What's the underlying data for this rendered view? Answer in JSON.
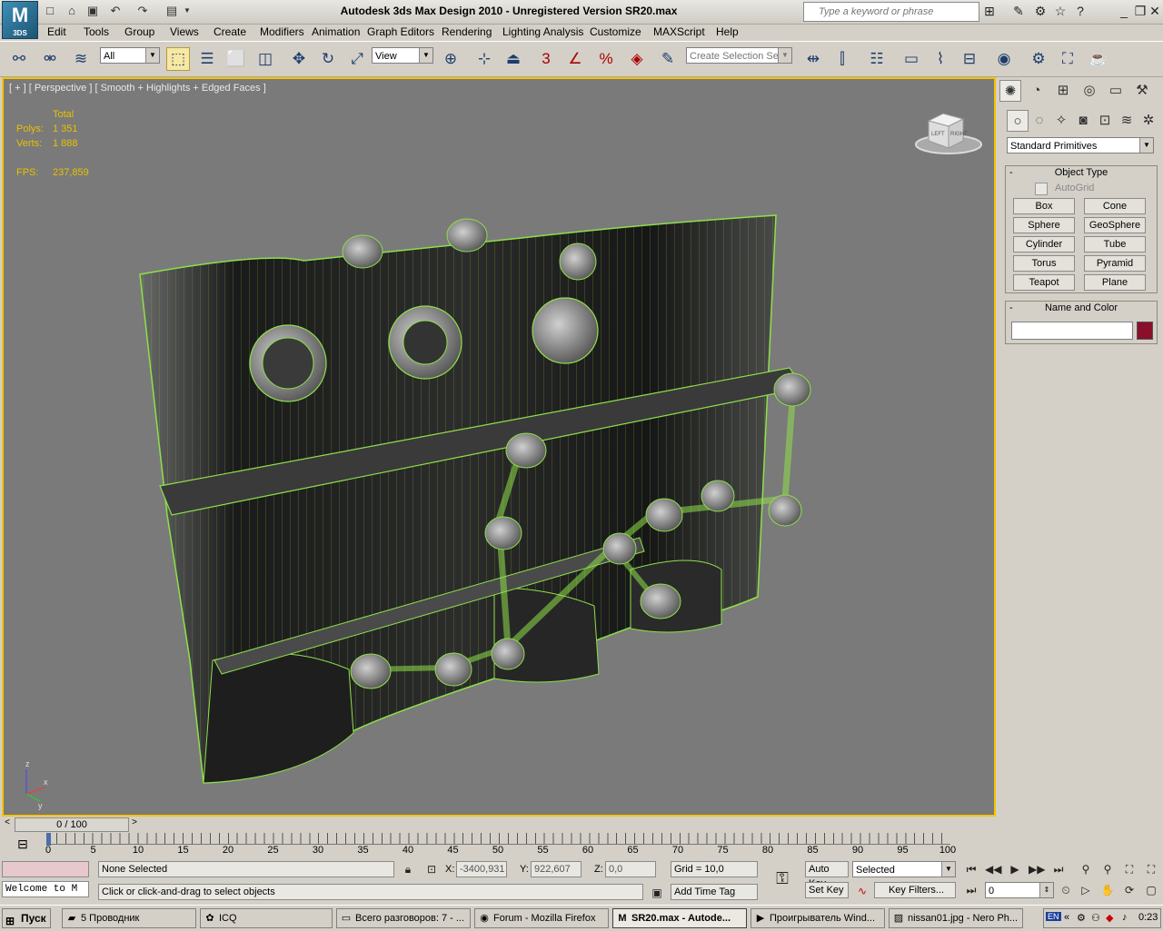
{
  "app": {
    "logo_text": "M",
    "logo_sub": "3DS",
    "title": "Autodesk 3ds Max Design 2010  - Unregistered Version    SR20.max"
  },
  "search": {
    "placeholder": "Type a keyword or phrase"
  },
  "menu": [
    "Edit",
    "Tools",
    "Group",
    "Views",
    "Create",
    "Modifiers",
    "Animation",
    "Graph Editors",
    "Rendering",
    "Lighting Analysis",
    "Customize",
    "MAXScript",
    "Help"
  ],
  "toolbar": {
    "selection_filter": "All",
    "reference_coord": "View",
    "snap_number": "3",
    "named_selection_placeholder": "Create Selection Se"
  },
  "viewport": {
    "label": "[ + ] [ Perspective ] [ Smooth + Highlights + Edged Faces ]",
    "stats_header": "Total",
    "polys_label": "Polys:",
    "polys_value": "1 351",
    "verts_label": "Verts:",
    "verts_value": "1 888",
    "fps_label": "FPS:",
    "fps_value": "237,859",
    "viewcube_left": "LEFT",
    "viewcube_right": "RIGHT",
    "axis_z": "z",
    "axis_x": "x",
    "axis_y": "y"
  },
  "command_panel": {
    "category_dropdown": "Standard Primitives",
    "object_type_title": "Object Type",
    "autogrid_label": "AutoGrid",
    "buttons": [
      "Box",
      "Cone",
      "Sphere",
      "GeoSphere",
      "Cylinder",
      "Tube",
      "Torus",
      "Pyramid",
      "Teapot",
      "Plane"
    ],
    "name_color_title": "Name and Color",
    "name_value": "",
    "object_color": "#8b0f2a",
    "rollout_minus": "-"
  },
  "timeline": {
    "frame_display": "0 / 100",
    "ticks": [
      "0",
      "5",
      "10",
      "15",
      "20",
      "25",
      "30",
      "35",
      "40",
      "45",
      "50",
      "55",
      "60",
      "65",
      "70",
      "75",
      "80",
      "85",
      "90",
      "95",
      "100"
    ]
  },
  "status": {
    "maxscript_listener": "Welcome to M",
    "selection_text": "None Selected",
    "prompt": "Click or click-and-drag to select objects",
    "x_label": "X:",
    "x_value": "-3400,931",
    "y_label": "Y:",
    "y_value": "922,607",
    "z_label": "Z:",
    "z_value": "0,0",
    "grid": "Grid = 10,0",
    "add_time_tag": "Add Time Tag",
    "auto_key": "Auto Key",
    "set_key": "Set Key",
    "key_mode": "Selected",
    "key_filters": "Key Filters...",
    "current_frame": "0"
  },
  "taskbar": {
    "start_label": "Пуск",
    "tasks": [
      "5 Проводник",
      "ICQ",
      "Всего разговоров: 7 - ...",
      "Forum - Mozilla Firefox",
      "SR20.max - Autode...",
      "Проигрыватель Wind...",
      "nissan01.jpg - Nero Ph..."
    ],
    "lang": "EN",
    "clock": "0:23"
  }
}
